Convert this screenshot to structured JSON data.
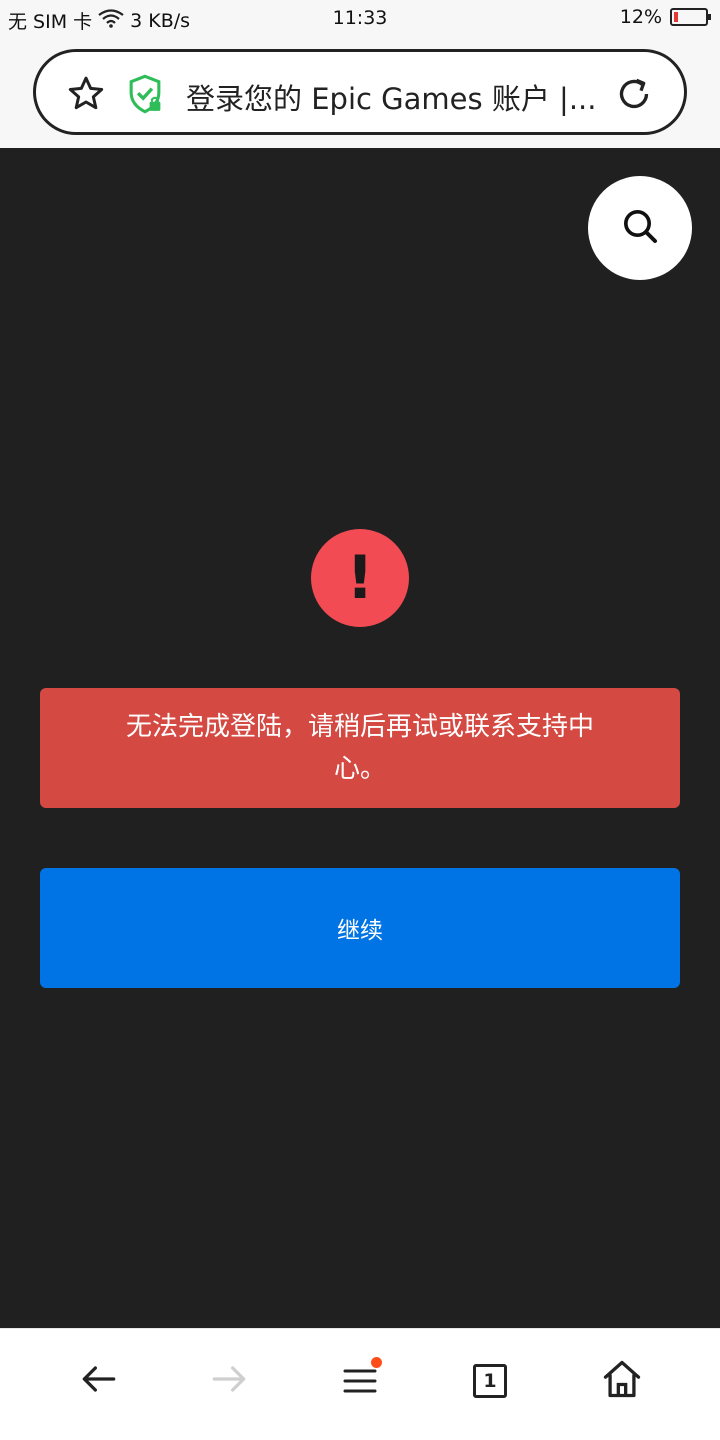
{
  "status_bar": {
    "carrier": "无 SIM 卡",
    "speed": "3 KB/s",
    "time": "11:33",
    "battery": "12%",
    "battery_level": 0.12
  },
  "browser": {
    "page_title": "登录您的 Epic Games 账户 |...",
    "icons": {
      "favorite": "star-icon",
      "security": "shield-check-icon",
      "reload": "reload-icon"
    }
  },
  "page": {
    "search_icon": "search-icon",
    "alert_symbol": "!",
    "error_message": "无法完成登陆，请稍后再试或联系支持中心。",
    "continue_label": "继续"
  },
  "bottom_nav": {
    "tabs_count": "1",
    "items": [
      "back-icon",
      "forward-icon",
      "menu-icon",
      "tabs-icon",
      "home-icon"
    ]
  },
  "colors": {
    "content_bg": "#202020",
    "alert_red": "#f24b54",
    "error_box": "#d44a43",
    "primary_blue": "#0074e4",
    "shield_green": "#2ebd59",
    "notification_dot": "#ff4d1a"
  }
}
